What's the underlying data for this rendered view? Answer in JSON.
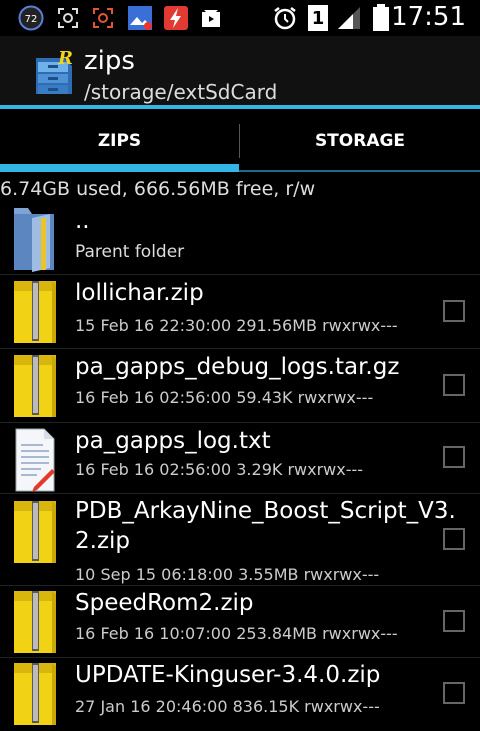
{
  "status_bar": {
    "battery_badge": "72",
    "sim_label": "1",
    "time": "17:51",
    "icons": [
      "battery-circle-icon",
      "screenshot-icon",
      "screen-record-icon",
      "image-icon",
      "flash-icon",
      "video-icon",
      "alarm-icon",
      "sim-icon",
      "signal-icon",
      "battery-icon"
    ]
  },
  "app_bar": {
    "title": "zips",
    "path": "/storage/extSdCard"
  },
  "tabs": [
    {
      "label": "ZIPS",
      "active": true
    },
    {
      "label": "STORAGE",
      "active": false
    }
  ],
  "disk_info": "6.74GB used, 666.56MB free, r/w",
  "parent": {
    "name": "..",
    "subtitle": "Parent folder"
  },
  "files": [
    {
      "name": "lollichar.zip",
      "meta": "15 Feb 16 22:30:00  291.56MB  rwxrwx---",
      "icon": "zip-icon"
    },
    {
      "name": "pa_gapps_debug_logs.tar.gz",
      "meta": "16 Feb 16 02:56:00  59.43K  rwxrwx---",
      "icon": "zip-icon"
    },
    {
      "name": "pa_gapps_log.txt",
      "meta": "16 Feb 16 02:56:00  3.29K  rwxrwx---",
      "icon": "text-file-icon"
    },
    {
      "name_line1": "PDB_ArkayNine_Boost_Script_V3.",
      "name_line2": "2.zip",
      "meta": "10 Sep 15 06:18:00  3.55MB  rwxrwx---",
      "icon": "zip-icon"
    },
    {
      "name": "SpeedRom2.zip",
      "meta": "16 Feb 16 10:07:00  253.84MB  rwxrwx---",
      "icon": "zip-icon"
    },
    {
      "name": "UPDATE-Kinguser-3.4.0.zip",
      "meta": "27 Jan 16 20:46:00  836.15K  rwxrwx---",
      "icon": "zip-icon"
    }
  ],
  "colors": {
    "accent": "#33b5e5",
    "folder_blue": "#5b86c0",
    "zip_yellow": "#f1d214"
  }
}
